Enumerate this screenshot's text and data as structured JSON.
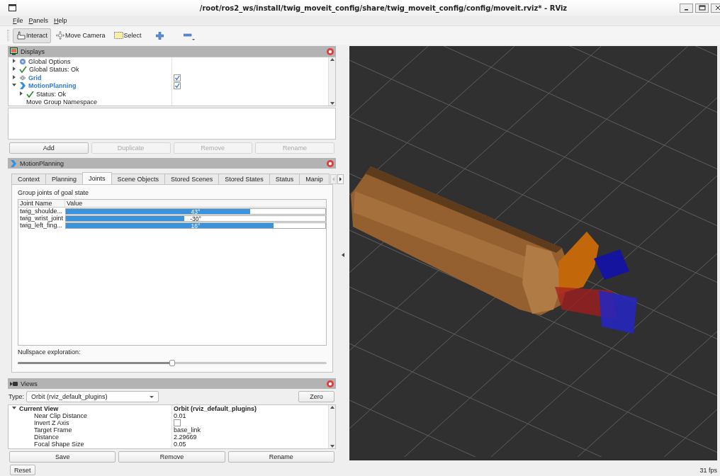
{
  "window": {
    "title": "/root/ros2_ws/install/twig_moveit_config/share/twig_moveit_config/config/moveit.rviz* - RViz"
  },
  "menu": [
    "File",
    "Panels",
    "Help"
  ],
  "toolbar": [
    {
      "kind": "interact",
      "label": "Interact",
      "selected": true
    },
    {
      "kind": "move-camera",
      "label": "Move Camera",
      "selected": false
    },
    {
      "kind": "select",
      "label": "Select",
      "selected": false
    },
    {
      "kind": "add",
      "selected": false
    },
    {
      "kind": "remove",
      "selected": false
    }
  ],
  "displays": {
    "title": "Displays",
    "tree": [
      {
        "kind": "options",
        "label": "Global Options",
        "expanded": false
      },
      {
        "kind": "status",
        "label": "Global Status: Ok",
        "expanded": false
      },
      {
        "kind": "grid",
        "label": "Grid",
        "expanded": false,
        "checked": true
      },
      {
        "kind": "motion",
        "label": "MotionPlanning",
        "expanded": true,
        "checked": true,
        "children": [
          {
            "kind": "status",
            "label": "Status: Ok",
            "expanded": false
          },
          {
            "kind": "property",
            "label": "Move Group Namespace"
          }
        ]
      }
    ],
    "buttons": [
      {
        "label": "Add",
        "disabled": false
      },
      {
        "label": "Duplicate",
        "disabled": true
      },
      {
        "label": "Remove",
        "disabled": true
      },
      {
        "label": "Rename",
        "disabled": true
      }
    ]
  },
  "motion_planning": {
    "title": "MotionPlanning",
    "tabs": [
      {
        "label": "Context",
        "selected": false
      },
      {
        "label": "Planning",
        "selected": false
      },
      {
        "label": "Joints",
        "selected": true
      },
      {
        "label": "Scene Objects",
        "selected": false
      },
      {
        "label": "Stored Scenes",
        "selected": false
      },
      {
        "label": "Stored States",
        "selected": false
      },
      {
        "label": "Status",
        "selected": false
      },
      {
        "label": "Manip",
        "selected": false
      }
    ],
    "group_label": "Group joints of goal state",
    "columns": [
      "Joint Name",
      "Value"
    ],
    "joints": [
      {
        "name": "twig_shoulde...",
        "value": "43°",
        "level": 0.71
      },
      {
        "name": "twig_wrist_joint",
        "value": "-30°",
        "level": 0.456
      },
      {
        "name": "twig_left_fing...",
        "value": "16°",
        "level": 0.8
      }
    ],
    "nullspace": {
      "label": "Nullspace exploration:",
      "level": 0.5
    }
  },
  "views": {
    "title": "Views",
    "type_label": "Type:",
    "type_value": "Orbit (rviz_default_plugins)",
    "zero": "Zero",
    "tree": [
      {
        "label": "Current View",
        "value": "Orbit (rviz_default_plugins)",
        "expanded": true,
        "children": [
          {
            "label": "Near Clip Distance",
            "value": "0.01"
          },
          {
            "label": "Invert Z Axis",
            "checked": false
          },
          {
            "label": "Target Frame",
            "value": "base_link"
          },
          {
            "label": "Distance",
            "value": "2.29669"
          },
          {
            "label": "Focal Shape Size",
            "value": "0.05"
          }
        ]
      }
    ],
    "buttons": [
      "Save",
      "Remove",
      "Rename"
    ]
  },
  "status_bar": {
    "reset": "Reset",
    "fps": "31 fps"
  }
}
